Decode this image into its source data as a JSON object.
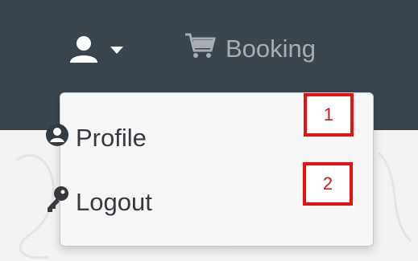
{
  "navbar": {
    "user_icon": "user-icon",
    "caret_icon": "caret-down-icon",
    "booking_icon": "shopping-cart-icon",
    "booking_label": "Booking"
  },
  "dropdown": {
    "items": [
      {
        "icon": "user-circle-icon",
        "label": "Profile"
      },
      {
        "icon": "key-icon",
        "label": "Logout"
      }
    ]
  },
  "annotations": {
    "markers": [
      {
        "label": "1"
      },
      {
        "label": "2"
      }
    ]
  },
  "colors": {
    "navbar_bg": "#3a454d",
    "marker_border": "#e81010",
    "menu_text": "#333a40"
  }
}
